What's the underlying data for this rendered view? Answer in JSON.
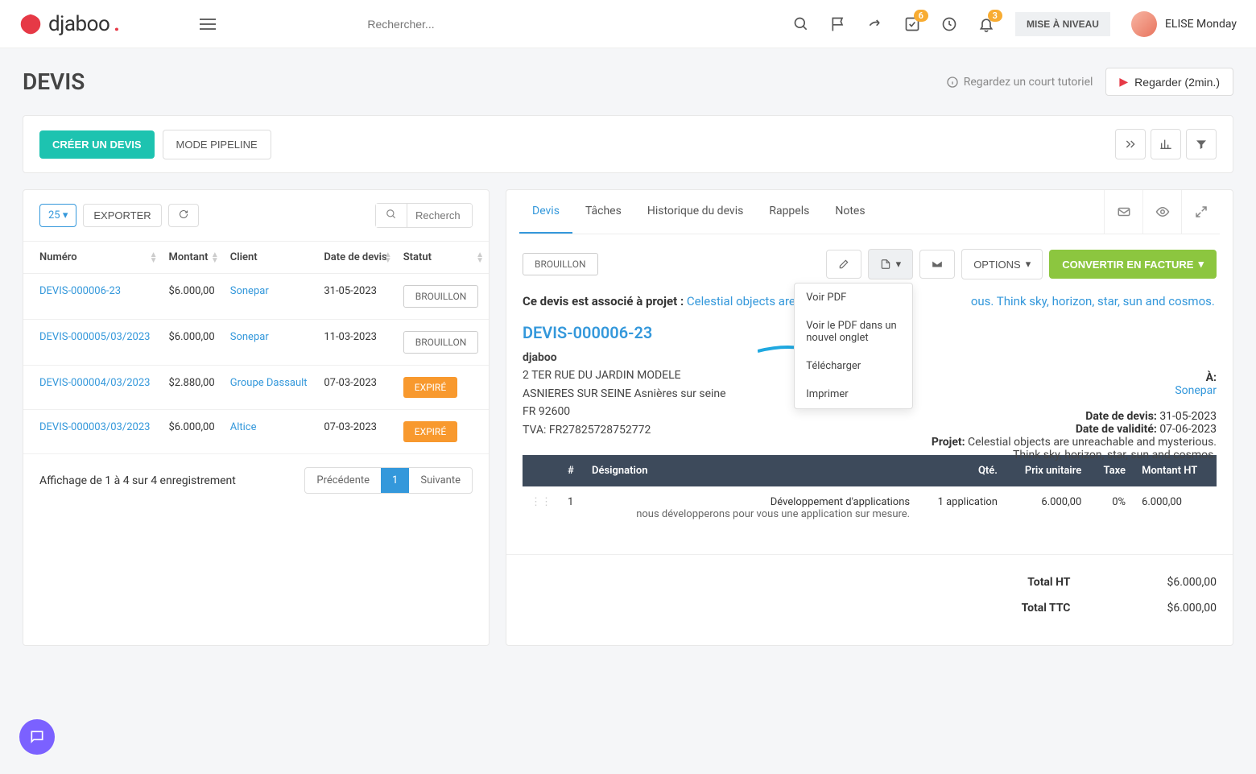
{
  "brand": "djaboo",
  "search_placeholder": "Rechercher...",
  "topbar": {
    "badge1": "6",
    "badge2": "3",
    "upgrade": "MISE À NIVEAU",
    "username": "ELISE Monday"
  },
  "page": {
    "title": "DEVIS",
    "tutorial_text": "Regardez un court tutoriel",
    "watch_label": "Regarder (2min.)"
  },
  "actions": {
    "create": "CRÉER UN DEVIS",
    "pipeline": "MODE PIPELINE"
  },
  "table": {
    "page_size": "25",
    "export": "EXPORTER",
    "search_placeholder": "Recherch",
    "cols": {
      "num": "Numéro",
      "amount": "Montant",
      "client": "Client",
      "date": "Date de devis",
      "status": "Statut"
    },
    "rows": [
      {
        "num": "DEVIS-000006-23",
        "amount": "$6.000,00",
        "client": "Sonepar",
        "date": "31-05-2023",
        "status": "BROUILLON",
        "st": "draft"
      },
      {
        "num": "DEVIS-000005/03/2023",
        "amount": "$6.000,00",
        "client": "Sonepar",
        "date": "11-03-2023",
        "status": "BROUILLON",
        "st": "draft"
      },
      {
        "num": "DEVIS-000004/03/2023",
        "amount": "$2.880,00",
        "client": "Groupe Dassault",
        "date": "07-03-2023",
        "status": "EXPIRÉ",
        "st": "exp"
      },
      {
        "num": "DEVIS-000003/03/2023",
        "amount": "$6.000,00",
        "client": "Altice",
        "date": "07-03-2023",
        "status": "EXPIRÉ",
        "st": "exp"
      }
    ],
    "footer_text": "Affichage de 1 à 4 sur 4 enregistrement",
    "prev": "Précédente",
    "page": "1",
    "next": "Suivante"
  },
  "tabs": {
    "devis": "Devis",
    "taches": "Tâches",
    "history": "Historique du devis",
    "rappels": "Rappels",
    "notes": "Notes"
  },
  "detail": {
    "draft_badge": "BROUILLON",
    "options": "OPTIONS",
    "convert": "CONVERTIR EN FACTURE",
    "pdf_menu": {
      "view": "Voir PDF",
      "view_tab": "Voir le PDF dans un nouvel onglet",
      "download": "Télécharger",
      "print": "Imprimer"
    },
    "assoc_prefix": "Ce devis est associé à projet : ",
    "assoc_link": "Celestial objects are u",
    "assoc_suffix": "ous. Think sky, horizon, star, sun and cosmos.",
    "quote_number": "DEVIS-000006-23",
    "sender": {
      "name": "djaboo",
      "addr1": "2 TER RUE DU JARDIN MODELE",
      "addr2": "ASNIERES SUR SEINE Asnières sur seine",
      "addr3": "FR 92600",
      "vat": "TVA: FR27825728752772"
    },
    "meta": {
      "to_label": "À:",
      "client": "Sonepar",
      "date_label": "Date de devis:",
      "date": "31-05-2023",
      "valid_label": "Date de validité:",
      "valid": "07-06-2023",
      "project_label": "Projet:",
      "project": "Celestial objects are unreachable and mysterious. Think sky, horizon, star, sun and cosmos."
    },
    "items_head": {
      "n": "#",
      "desc": "Désignation",
      "qty": "Qté.",
      "price": "Prix unitaire",
      "tax": "Taxe",
      "total": "Montant HT"
    },
    "item": {
      "n": "1",
      "title": "Développement d'applications",
      "sub": "nous développerons pour vous une application sur mesure.",
      "qty": "1 application",
      "price": "6.000,00",
      "tax": "0%",
      "total": "6.000,00"
    },
    "totals": {
      "ht_label": "Total HT",
      "ht": "$6.000,00",
      "ttc_label": "Total TTC",
      "ttc": "$6.000,00"
    }
  }
}
